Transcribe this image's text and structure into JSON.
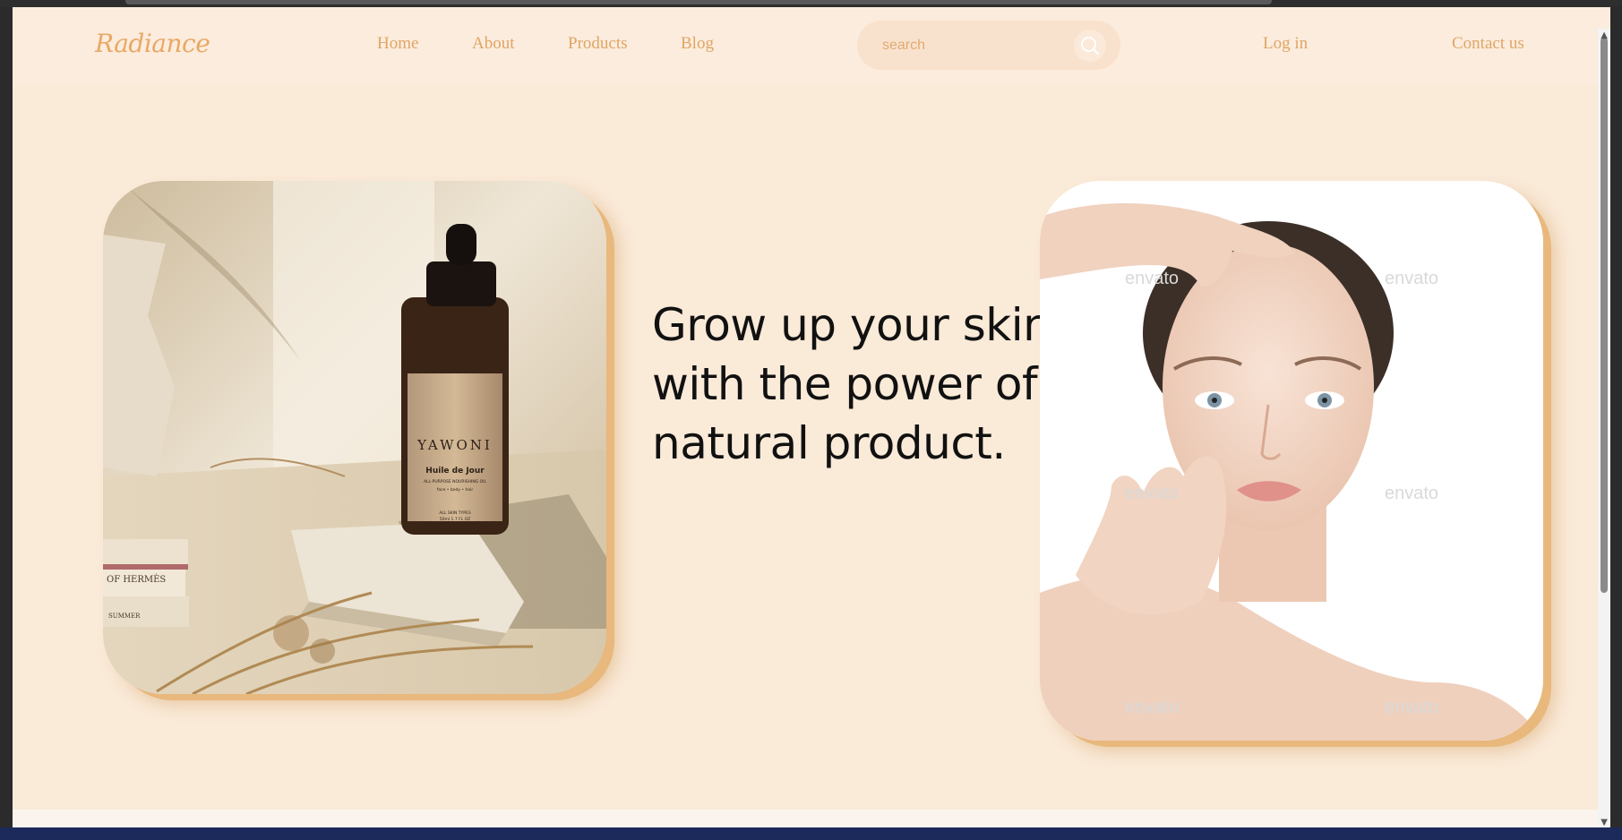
{
  "brand": {
    "logo": "Radiance"
  },
  "nav": {
    "links": [
      {
        "label": "Home"
      },
      {
        "label": "About"
      },
      {
        "label": "Products"
      },
      {
        "label": "Blog"
      }
    ],
    "login": "Log in",
    "contact": "Contact us"
  },
  "search": {
    "placeholder": "search"
  },
  "hero": {
    "headline": "Grow up your skin with the power of natural product.",
    "product": {
      "brand": "YAWONI",
      "name": "Huile de Jour",
      "subtitle": "ALL-PURPOSE NOURISHING OIL",
      "uses": "face • body • hair",
      "skin": "ALL SKIN TYPES",
      "volume": "50ml 1.7 FL OZ"
    },
    "books": [
      "OF HERMÈS",
      "SUMMER"
    ],
    "watermark": "envato"
  },
  "colors": {
    "background": "#faead8",
    "navbar": "#fbecdd",
    "accent": "#e0a565",
    "frame_shadow": "#e8b87c"
  },
  "icons": [
    "search-icon",
    "chevron-up-icon",
    "chevron-down-icon"
  ]
}
